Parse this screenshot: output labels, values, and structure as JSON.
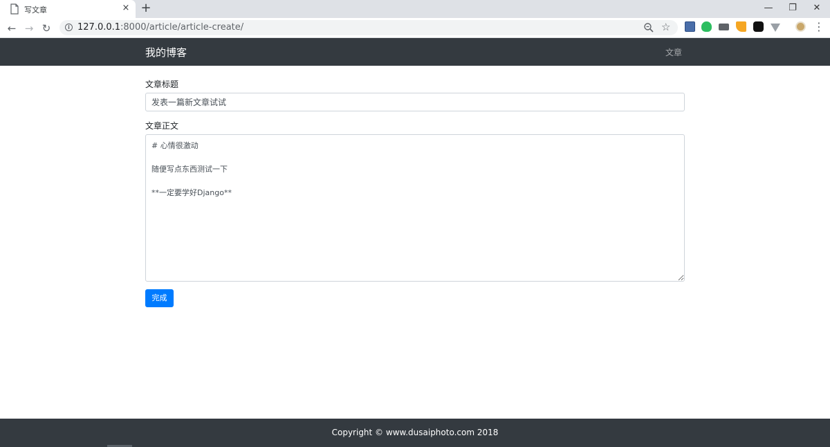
{
  "browser": {
    "tab_title": "写文章",
    "tab_close": "×",
    "new_tab": "+",
    "url_host": "127.0.0.1",
    "url_rest": ":8000/article/article-create/",
    "info_glyph": "i",
    "back_glyph": "←",
    "forward_glyph": "→",
    "reload_glyph": "↻",
    "star_glyph": "☆",
    "menu_glyph": "⋮",
    "minimize_glyph": "—",
    "restore_glyph": "❐",
    "close_glyph": "✕",
    "extensions": [
      "bookmark-extension-icon",
      "evernote-icon",
      "mail-icon",
      "rss-icon",
      "tampermonkey-icon",
      "vue-devtools-icon",
      "profile-avatar-icon"
    ]
  },
  "navbar": {
    "brand": "我的博客",
    "link": "文章"
  },
  "form": {
    "title_label": "文章标题",
    "title_value": "发表一篇新文章试试",
    "body_label": "文章正文",
    "body_value": "# 心情很激动\n\n随便写点东西测试一下\n\n**一定要学好Django**",
    "submit_label": "完成"
  },
  "footer": {
    "text": "Copyright © www.dusaiphoto.com 2018"
  },
  "colors": {
    "navbar_bg": "#343a40",
    "primary": "#007bff",
    "tabstrip_bg": "#dee1e6"
  }
}
